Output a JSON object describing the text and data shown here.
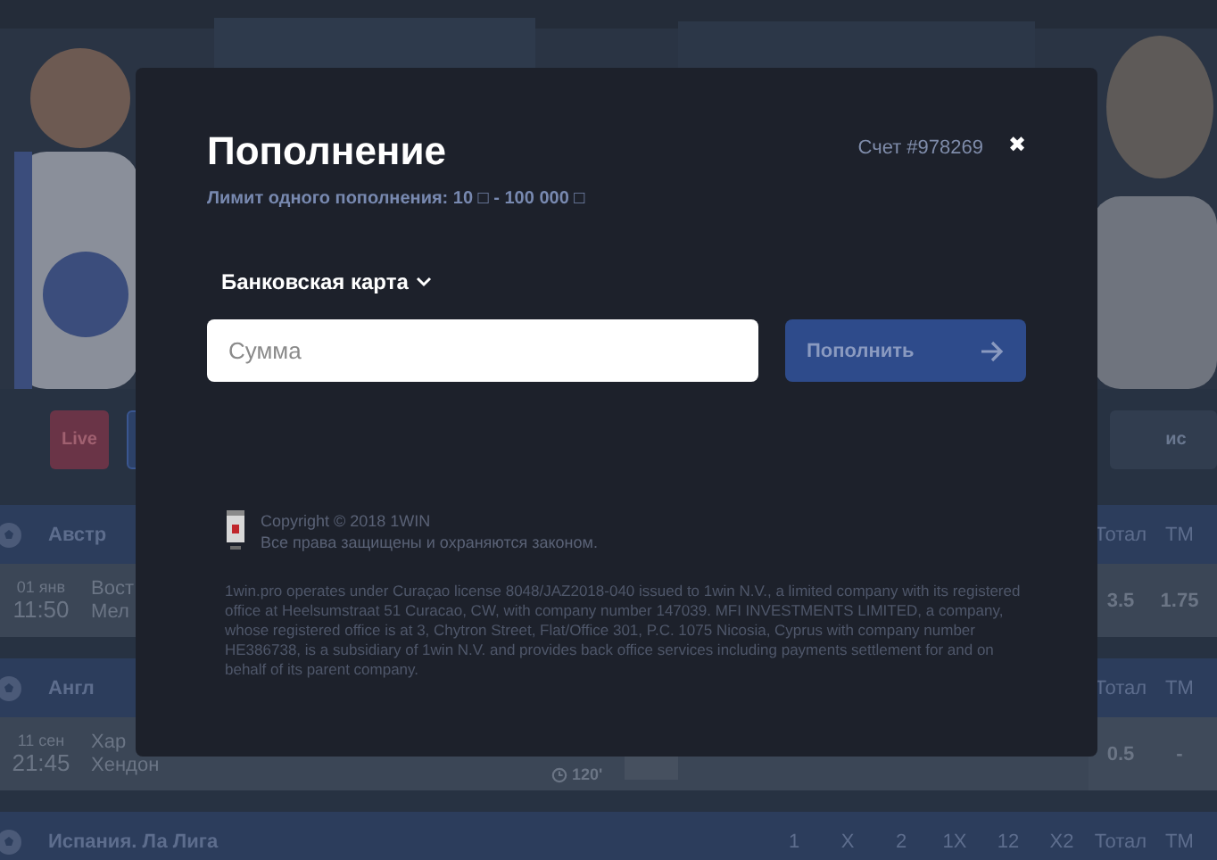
{
  "filter_buttons": [
    {
      "kind": "live",
      "label": "Live"
    },
    {
      "kind": "blank"
    },
    {
      "kind": "plain",
      "label": "ис"
    }
  ],
  "leagues": [
    {
      "name": "Австр",
      "columns": [
        "Тотал",
        "ТМ"
      ],
      "match": {
        "date": "01 янв",
        "time": "11:50",
        "team_1": "Вост",
        "team_2": "Мел",
        "odds": [
          "3.5",
          "1.75"
        ]
      }
    },
    {
      "name": "Англ",
      "columns": [
        "Тотал",
        "ТМ"
      ],
      "match": {
        "date": "11 сен",
        "time": "21:45",
        "team_1": "Хар",
        "team_2": "Хендон",
        "timer": "120'",
        "odds": [
          "0.5",
          "-"
        ]
      }
    },
    {
      "name": "Испания. Ла Лига",
      "columns": [
        "1",
        "X",
        "2",
        "1X",
        "12",
        "X2",
        "Тотал",
        "ТМ"
      ]
    }
  ],
  "modal": {
    "title": "Пополнение",
    "account": "Счет #978269",
    "close": "✖",
    "limit": "Лимит одного пополнения: 10 □ - 100 000 □",
    "method": {
      "label": "Банковская карта",
      "expanded": false
    },
    "amount": {
      "placeholder": "Сумма"
    },
    "submit": "Пополнить",
    "copyright": [
      "Copyright © 2018 1WIN",
      "Все права защищены и охраняются законом."
    ],
    "legal": "1win.pro operates under Curaçao license 8048/JAZ2018-040 issued to 1win N.V., a limited company with its registered office at Heelsumstraat 51 Curacao, CW, with company number 147039. MFI INVESTMENTS LIMITED, a company, whose registered office is at 3, Chytron Street, Flat/Office 301, P.C. 1075 Nicosia, Cyprus with company number HE386738, is a subsidiary of 1win N.V. and provides back office services including payments settlement for and on behalf of its parent company."
  }
}
